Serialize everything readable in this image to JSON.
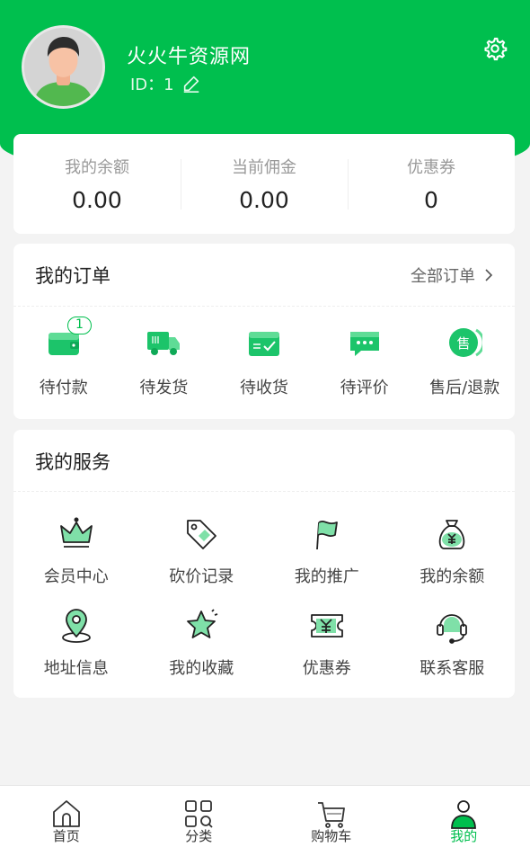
{
  "profile": {
    "name": "火火牛资源网",
    "id_label": "ID：1"
  },
  "balance": [
    {
      "label": "我的余额",
      "value": "0.00"
    },
    {
      "label": "当前佣金",
      "value": "0.00"
    },
    {
      "label": "优惠券",
      "value": "0"
    }
  ],
  "orders": {
    "title": "我的订单",
    "all_label": "全部订单",
    "items": [
      {
        "label": "待付款",
        "icon": "wallet-icon",
        "badge": "1"
      },
      {
        "label": "待发货",
        "icon": "truck-icon"
      },
      {
        "label": "待收货",
        "icon": "box-check-icon"
      },
      {
        "label": "待评价",
        "icon": "comment-icon"
      },
      {
        "label": "售后/退款",
        "icon": "after-sale-icon",
        "icon_text": "售"
      }
    ]
  },
  "services": {
    "title": "我的服务",
    "items": [
      {
        "label": "会员中心",
        "icon": "crown-icon"
      },
      {
        "label": "砍价记录",
        "icon": "price-tag-icon"
      },
      {
        "label": "我的推广",
        "icon": "flag-icon"
      },
      {
        "label": "我的余额",
        "icon": "money-bag-icon"
      },
      {
        "label": "地址信息",
        "icon": "location-pin-icon"
      },
      {
        "label": "我的收藏",
        "icon": "star-icon"
      },
      {
        "label": "优惠券",
        "icon": "coupon-icon"
      },
      {
        "label": "联系客服",
        "icon": "headset-icon"
      }
    ]
  },
  "tabbar": [
    {
      "label": "首页",
      "icon": "home-icon"
    },
    {
      "label": "分类",
      "icon": "category-icon"
    },
    {
      "label": "购物车",
      "icon": "cart-icon"
    },
    {
      "label": "我的",
      "icon": "user-icon",
      "active": true
    }
  ],
  "colors": {
    "brand": "#00bf4e",
    "background": "#f3f3f3"
  }
}
